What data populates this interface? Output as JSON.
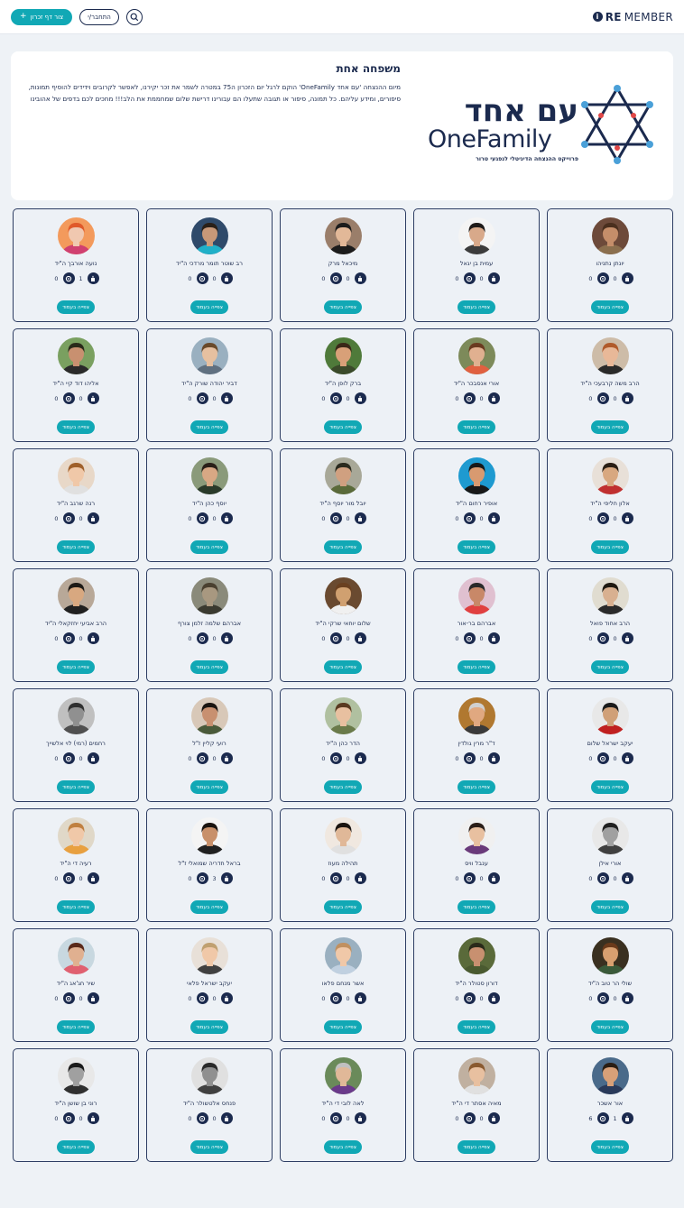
{
  "header": {
    "logo_bold": "RE",
    "logo_rest": "MEMBER",
    "create_label": "צור דף זכרון",
    "login_label": "התחבר/י"
  },
  "hero": {
    "title": "משפחה אחת",
    "description": "מיום ההנצחה 'עם אחד OneFamily' הוקם לרגל יום הזכרון ה75 במטרה לשמר את זכר יקירנו, לאפשר לקרובים וידידים להוסיף תמונות, סיפורים, ומידע עליהם. כל תמונה, סיפור או תגובה שתעלו הם עבורינו דרישת שלום שמחממת את הלב!!! מחכים לכם בדפים של אהובינו",
    "logo_hebrew": "עם אחד",
    "logo_english": "OneFamily",
    "logo_subtitle": "פרוייקט ההנצחה הדיגיטלי לנפגעי טרור"
  },
  "view_label": "צפייה בעמוד",
  "colors": {
    "accent": "#11a8b5",
    "navy": "#1b2a4e",
    "card_border": "#2d3d63"
  },
  "cards": [
    {
      "name": "יונתן נתניהו",
      "likes": "0",
      "candles": "0",
      "skin": "#c58e6a",
      "hair": "#4a2f1e",
      "bg": "#6d4a3a",
      "shirt": "#8b6f4e"
    },
    {
      "name": "עמית בן יגאל",
      "likes": "0",
      "candles": "0",
      "skin": "#d8a98a",
      "hair": "#1e1a18",
      "bg": "#f4f4f4",
      "shirt": "#3c3c3c"
    },
    {
      "name": "מיכאל מרק",
      "likes": "0",
      "candles": "0",
      "skin": "#e2b898",
      "hair": "#1c1c1c",
      "bg": "#9a7e6a",
      "shirt": "#1c1c1c"
    },
    {
      "name": "רב שוטר תומר מרדכי ה\"יד",
      "likes": "0",
      "candles": "0",
      "skin": "#c89878",
      "hair": "#2a2018",
      "bg": "#2f4a6a",
      "shirt": "#20b0c8"
    },
    {
      "name": "נועה אורבך ה\"יד",
      "likes": "1",
      "candles": "0",
      "skin": "#f0c8b0",
      "hair": "#e05a2a",
      "bg": "#f39a5c",
      "shirt": "#d04070"
    },
    {
      "name": "הרב משה קרבעכי ה\"יד",
      "likes": "0",
      "candles": "0",
      "skin": "#e8b898",
      "hair": "#b05a2a",
      "bg": "#cdbca8",
      "shirt": "#2a2a2a"
    },
    {
      "name": "אורי אנסבכר ה\"יד",
      "likes": "0",
      "candles": "0",
      "skin": "#e0b090",
      "hair": "#6a3a20",
      "bg": "#7d8a5a",
      "shirt": "#e06040"
    },
    {
      "name": "ברק לופן ה\"יד",
      "likes": "0",
      "candles": "0",
      "skin": "#d8a078",
      "hair": "#3a2818",
      "bg": "#4f7a3a",
      "shirt": "#3a4a2a"
    },
    {
      "name": "דביר יהודה שורק ה\"יד",
      "likes": "0",
      "candles": "0",
      "skin": "#e6c0a0",
      "hair": "#6a4a2a",
      "bg": "#9ab0c0",
      "shirt": "#607080"
    },
    {
      "name": "אליהו דוד קיי ה\"יד",
      "likes": "0",
      "candles": "0",
      "skin": "#c89070",
      "hair": "#2a2a1a",
      "bg": "#7aa060",
      "shirt": "#2a2a2a"
    },
    {
      "name": "אלון חליפי ה\"יד",
      "likes": "0",
      "candles": "0",
      "skin": "#d8a880",
      "hair": "#2a1e14",
      "bg": "#e8e0d8",
      "shirt": "#c03030"
    },
    {
      "name": "אופיר רחום ה\"יד",
      "likes": "0",
      "candles": "0",
      "skin": "#d89a70",
      "hair": "#181818",
      "bg": "#1e9ad0",
      "shirt": "#181818"
    },
    {
      "name": "יובל מור יוסף ה\"יד",
      "likes": "0",
      "candles": "0",
      "skin": "#d0a080",
      "hair": "#2a2a1e",
      "bg": "#a8a898",
      "shirt": "#5a6a3a"
    },
    {
      "name": "יוסף כהן ה\"יד",
      "likes": "0",
      "candles": "0",
      "skin": "#d8a884",
      "hair": "#2a2018",
      "bg": "#8a9a7a",
      "shirt": "#2a3a2a"
    },
    {
      "name": "רנה שרגב ה\"יד",
      "likes": "0",
      "candles": "0",
      "skin": "#f0c8a8",
      "hair": "#a0602a",
      "bg": "#e8d8c8",
      "shirt": "#e0e0e0"
    },
    {
      "name": "הרב אחוד פואל",
      "likes": "0",
      "candles": "0",
      "skin": "#d8b090",
      "hair": "#1e1810",
      "bg": "#e0dcd0",
      "shirt": "#2a2a2a"
    },
    {
      "name": "אברהם בר-אור",
      "likes": "0",
      "candles": "0",
      "skin": "#c88868",
      "hair": "#2a2a2a",
      "bg": "#e0c0d0",
      "shirt": "#e04040"
    },
    {
      "name": "שלום יוחאי שרקי ה\"יד",
      "likes": "0",
      "candles": "0",
      "skin": "#d0a070",
      "hair": "#6a4020",
      "bg": "#6a4a30",
      "shirt": "#f0f0f0"
    },
    {
      "name": "אברהם שלמה זלמן צורף",
      "likes": "0",
      "candles": "0",
      "skin": "#a89880",
      "hair": "#4a4030",
      "bg": "#8a8a7a",
      "shirt": "#3a3a30"
    },
    {
      "name": "הרב אביעי יחזקאלי ה\"יד",
      "likes": "0",
      "candles": "0",
      "skin": "#d8a880",
      "hair": "#1e1a16",
      "bg": "#b8a898",
      "shirt": "#202020"
    },
    {
      "name": "יעקב ישראל שלום",
      "likes": "0",
      "candles": "0",
      "skin": "#d0a078",
      "hair": "#1a1a1a",
      "bg": "#e8e8e8",
      "shirt": "#c02020"
    },
    {
      "name": "ד\"ר מרין גולדין",
      "likes": "0",
      "candles": "0",
      "skin": "#e0a880",
      "hair": "#d0d0d0",
      "bg": "#b07830",
      "shirt": "#3a3a3a"
    },
    {
      "name": "הדר כהן ה\"יד",
      "likes": "0",
      "candles": "0",
      "skin": "#e8c0a0",
      "hair": "#5a3a20",
      "bg": "#b0c0a0",
      "shirt": "#6a7a4a"
    },
    {
      "name": "רועי קליין ז\"ל",
      "likes": "0",
      "candles": "0",
      "skin": "#c89070",
      "hair": "#1a1410",
      "bg": "#d8c8b8",
      "shirt": "#4a5a3a"
    },
    {
      "name": "רחמים (רמי) לוי אלשייך",
      "likes": "0",
      "candles": "0",
      "skin": "#909090",
      "hair": "#303030",
      "bg": "#c0c0c0",
      "shirt": "#505050"
    },
    {
      "name": "אורי אילן",
      "likes": "0",
      "candles": "0",
      "skin": "#a0a0a0",
      "hair": "#202020",
      "bg": "#e8e8e8",
      "shirt": "#404040"
    },
    {
      "name": "ענבל וויס",
      "likes": "0",
      "candles": "0",
      "skin": "#e8c0a0",
      "hair": "#2a1e18",
      "bg": "#f0f0f0",
      "shirt": "#6a3a7a"
    },
    {
      "name": "תהילה מעוז",
      "likes": "0",
      "candles": "0",
      "skin": "#e0b898",
      "hair": "#1a1410",
      "bg": "#f0e8e0",
      "shirt": "#e0e0e0"
    },
    {
      "name": "בראל חדריה שמואלי ז\"ל",
      "likes": "3",
      "candles": "0",
      "skin": "#c8906a",
      "hair": "#1a1410",
      "bg": "#f4f4f4",
      "shirt": "#202020"
    },
    {
      "name": "רעיה די ה\"יד",
      "likes": "0",
      "candles": "0",
      "skin": "#f0c8a8",
      "hair": "#c08040",
      "bg": "#e0d8c8",
      "shirt": "#e8a040"
    },
    {
      "name": "שולי הר טוב ה\"יד",
      "likes": "0",
      "candles": "0",
      "skin": "#d8a070",
      "hair": "#6a3a1a",
      "bg": "#3a3020",
      "shirt": "#3a5a3a"
    },
    {
      "name": "דורון סטולר ה\"יד",
      "likes": "0",
      "candles": "0",
      "skin": "#c89070",
      "hair": "#2a2a1a",
      "bg": "#5a6a3a",
      "shirt": "#4a5a30"
    },
    {
      "name": "אשר מנחם פלאו",
      "likes": "0",
      "candles": "0",
      "skin": "#f0c8a8",
      "hair": "#c09060",
      "bg": "#9ab0c0",
      "shirt": "#c0d0e0"
    },
    {
      "name": "יעקב ישראל פלאי",
      "likes": "0",
      "candles": "0",
      "skin": "#f0c8a8",
      "hair": "#c0a070",
      "bg": "#e8e0d8",
      "shirt": "#404040"
    },
    {
      "name": "שיר חג'אג ה\"יד",
      "likes": "0",
      "candles": "0",
      "skin": "#e0b090",
      "hair": "#5a2a1a",
      "bg": "#c8d8e0",
      "shirt": "#e06070"
    },
    {
      "name": "אור אשכר",
      "likes": "1",
      "candles": "6",
      "skin": "#d8a078",
      "hair": "#2a1e14",
      "bg": "#4a6a8a",
      "shirt": "#2a3a5a"
    },
    {
      "name": "מאיה אסתר די ה\"יד",
      "likes": "0",
      "candles": "0",
      "skin": "#e8c0a0",
      "hair": "#8a5a30",
      "bg": "#c0b0a0",
      "shirt": "#e0e0e0"
    },
    {
      "name": "לאה לובי די ה\"יד",
      "likes": "0",
      "candles": "0",
      "skin": "#e0b898",
      "hair": "#c0c0c0",
      "bg": "#6a8a5a",
      "shirt": "#6a3a8a"
    },
    {
      "name": "פנחס אלטשולר ה\"יד",
      "likes": "0",
      "candles": "0",
      "skin": "#909090",
      "hair": "#2a2a2a",
      "bg": "#e0e0e0",
      "shirt": "#404040"
    },
    {
      "name": "רוני בן שושן ה\"יד",
      "likes": "0",
      "candles": "0",
      "skin": "#a0a0a0",
      "hair": "#1a1a1a",
      "bg": "#e8e8e8",
      "shirt": "#303030"
    }
  ]
}
